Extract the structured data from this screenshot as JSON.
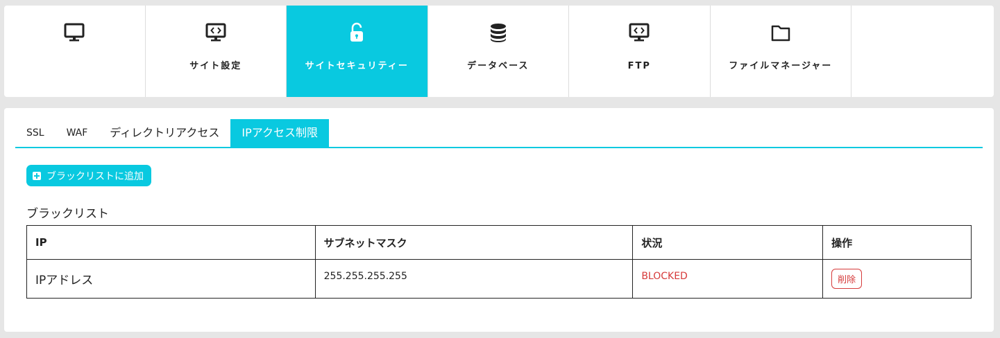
{
  "nav": {
    "items": [
      {
        "label": "",
        "icon": "monitor-icon"
      },
      {
        "label": "サイト設定",
        "icon": "code-monitor-icon"
      },
      {
        "label": "サイトセキュリティー",
        "icon": "unlock-icon"
      },
      {
        "label": "データベース",
        "icon": "database-icon"
      },
      {
        "label": "FTP",
        "icon": "code-monitor-icon"
      },
      {
        "label": "ファイルマネージャー",
        "icon": "folder-icon"
      }
    ],
    "active_index": 2
  },
  "tabs": {
    "items": [
      {
        "label": "SSL"
      },
      {
        "label": "WAF"
      },
      {
        "label": "ディレクトリアクセス"
      },
      {
        "label": "IPアクセス制限"
      }
    ],
    "active_index": 3
  },
  "actions": {
    "add_blacklist_label": "ブラックリストに追加"
  },
  "blacklist": {
    "title": "ブラックリスト",
    "columns": [
      "IP",
      "サブネットマスク",
      "状況",
      "操作"
    ],
    "rows": [
      {
        "ip": "IPアドレス",
        "mask": "255.255.255.255",
        "status": "BLOCKED",
        "action": "削除"
      }
    ]
  },
  "colors": {
    "accent": "#09c9e0",
    "danger": "#d63a3a"
  }
}
